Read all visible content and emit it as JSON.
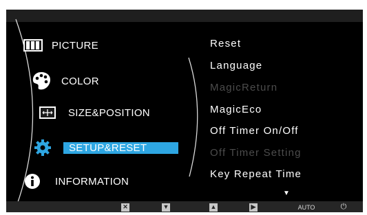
{
  "main_menu": {
    "items": [
      {
        "label": "PICTURE",
        "icon": "picture-icon",
        "selected": false
      },
      {
        "label": "COLOR",
        "icon": "palette-icon",
        "selected": false
      },
      {
        "label": "SIZE&POSITION",
        "icon": "size-position-icon",
        "selected": false
      },
      {
        "label": "SETUP&RESET",
        "icon": "gear-icon",
        "selected": true
      },
      {
        "label": "INFORMATION",
        "icon": "info-icon",
        "selected": false
      }
    ]
  },
  "sub_menu": {
    "items": [
      {
        "label": "Reset",
        "enabled": true
      },
      {
        "label": "Language",
        "enabled": true
      },
      {
        "label": "MagicReturn",
        "enabled": false
      },
      {
        "label": "MagicEco",
        "enabled": true
      },
      {
        "label": "Off Timer On/Off",
        "enabled": true
      },
      {
        "label": "Off Timer Setting",
        "enabled": false
      },
      {
        "label": "Key Repeat Time",
        "enabled": true
      }
    ],
    "more_indicator": "▼"
  },
  "bottom_bar": {
    "buttons": [
      {
        "icon": "close-icon",
        "label": ""
      },
      {
        "icon": "down-arrow-icon",
        "label": ""
      },
      {
        "icon": "up-arrow-icon",
        "label": ""
      },
      {
        "icon": "enter-icon",
        "label": ""
      },
      {
        "icon": "auto-icon",
        "label": "AUTO"
      },
      {
        "icon": "power-icon",
        "label": "⏻"
      }
    ]
  },
  "colors": {
    "background": "#000000",
    "selection": "#2ea6e2",
    "text": "#ffffff",
    "disabled_text": "#4c4c4c"
  }
}
